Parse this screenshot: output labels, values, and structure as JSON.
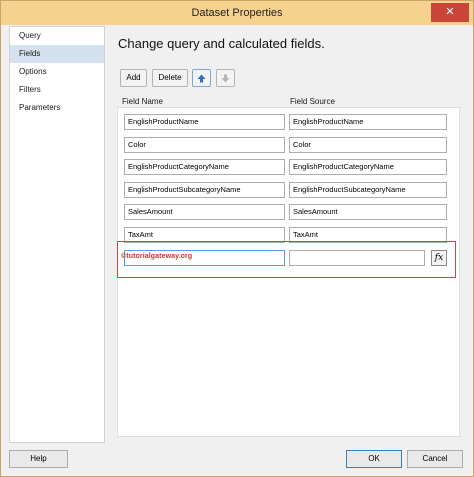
{
  "window": {
    "title": "Dataset Properties",
    "close_glyph": "✕"
  },
  "nav": {
    "items": [
      {
        "label": "Query",
        "active": false
      },
      {
        "label": "Fields",
        "active": true
      },
      {
        "label": "Options",
        "active": false
      },
      {
        "label": "Filters",
        "active": false
      },
      {
        "label": "Parameters",
        "active": false
      }
    ]
  },
  "main": {
    "heading": "Change query and calculated fields.",
    "toolbar": {
      "add_label": "Add",
      "delete_label": "Delete",
      "move_up_icon": "arrow-up-icon",
      "move_down_icon": "arrow-down-icon"
    },
    "columns": {
      "field_name": "Field Name",
      "field_source": "Field Source"
    },
    "fields": [
      {
        "name": "EnglishProductName",
        "source": "EnglishProductName"
      },
      {
        "name": "Color",
        "source": "Color"
      },
      {
        "name": "EnglishProductCategoryName",
        "source": "EnglishProductCategoryName"
      },
      {
        "name": "EnglishProductSubcategoryName",
        "source": "EnglishProductSubcategoryName"
      },
      {
        "name": "SalesAmount",
        "source": "SalesAmount"
      },
      {
        "name": "TaxAmt",
        "source": "TaxAmt"
      },
      {
        "name": "",
        "source": ""
      }
    ],
    "expression_button": "fx",
    "watermark": "©tutorialgateway.org"
  },
  "footer": {
    "help_label": "Help",
    "ok_label": "OK",
    "cancel_label": "Cancel"
  },
  "colors": {
    "title_bar": "#f6d28f",
    "selected_nav": "#d5e1ee",
    "highlight_border": "#c44a4a",
    "watermark": "#c0392b"
  }
}
